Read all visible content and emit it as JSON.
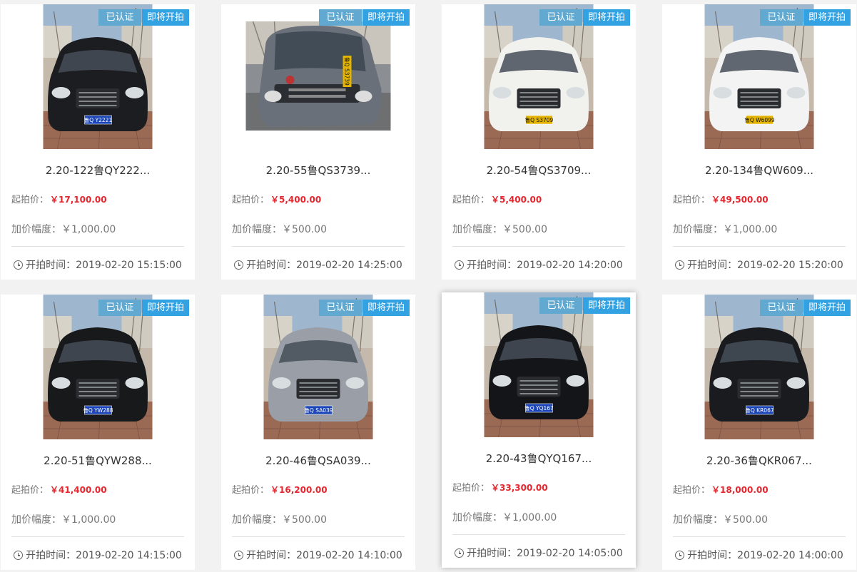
{
  "listings": [
    {
      "title": "2.20-122鲁QY222...",
      "start_price_label": "起拍价：",
      "start_price": "￥17,100.00",
      "increment_label": "加价幅度：",
      "increment": "￥1,000.00",
      "time_label": "开拍时间：",
      "time": "2019-02-20 15:15:00",
      "badge_certified": "已认证",
      "badge_status": "即将开拍",
      "plate": "鲁Q Y2221",
      "car_color": "#1c1d20",
      "plate_color": "#1c46b8"
    },
    {
      "title": "2.20-55鲁QS3739...",
      "start_price_label": "起拍价：",
      "start_price": "￥5,400.00",
      "increment_label": "加价幅度：",
      "increment": "￥500.00",
      "time_label": "开拍时间：",
      "time": "2019-02-20 14:25:00",
      "badge_certified": "已认证",
      "badge_status": "即将开拍",
      "plate": "鲁Q S3739",
      "car_color": "#6a7079",
      "plate_color": "#e4b400"
    },
    {
      "title": "2.20-54鲁QS3709...",
      "start_price_label": "起拍价：",
      "start_price": "￥5,400.00",
      "increment_label": "加价幅度：",
      "increment": "￥500.00",
      "time_label": "开拍时间：",
      "time": "2019-02-20 14:20:00",
      "badge_certified": "已认证",
      "badge_status": "即将开拍",
      "plate": "鲁Q S3709",
      "car_color": "#f1f1ee",
      "plate_color": "#e4b400"
    },
    {
      "title": "2.20-134鲁QW609...",
      "start_price_label": "起拍价：",
      "start_price": "￥49,500.00",
      "increment_label": "加价幅度：",
      "increment": "￥1,000.00",
      "time_label": "开拍时间：",
      "time": "2019-02-20 15:20:00",
      "badge_certified": "已认证",
      "badge_status": "即将开拍",
      "plate": "鲁Q W6099",
      "car_color": "#f3f3f3",
      "plate_color": "#e4b400"
    },
    {
      "title": "2.20-51鲁QYW288...",
      "start_price_label": "起拍价：",
      "start_price": "￥41,400.00",
      "increment_label": "加价幅度：",
      "increment": "￥1,000.00",
      "time_label": "开拍时间：",
      "time": "2019-02-20 14:15:00",
      "badge_certified": "已认证",
      "badge_status": "即将开拍",
      "plate": "鲁Q YW288",
      "car_color": "#18191b",
      "plate_color": "#1c46b8"
    },
    {
      "title": "2.20-46鲁QSA039...",
      "start_price_label": "起拍价：",
      "start_price": "￥16,200.00",
      "increment_label": "加价幅度：",
      "increment": "￥500.00",
      "time_label": "开拍时间：",
      "time": "2019-02-20 14:10:00",
      "badge_certified": "已认证",
      "badge_status": "即将开拍",
      "plate": "鲁Q SA039",
      "car_color": "#9a9ea6",
      "plate_color": "#1c46b8"
    },
    {
      "title": "2.20-43鲁QYQ167...",
      "start_price_label": "起拍价：",
      "start_price": "￥33,300.00",
      "increment_label": "加价幅度：",
      "increment": "￥1,000.00",
      "time_label": "开拍时间：",
      "time": "2019-02-20 14:05:00",
      "badge_certified": "已认证",
      "badge_status": "即将开拍",
      "plate": "鲁Q YQ167",
      "car_color": "#141518",
      "plate_color": "#1c46b8"
    },
    {
      "title": "2.20-36鲁QKR067...",
      "start_price_label": "起拍价：",
      "start_price": "￥18,000.00",
      "increment_label": "加价幅度：",
      "increment": "￥500.00",
      "time_label": "开拍时间：",
      "time": "2019-02-20 14:00:00",
      "badge_certified": "已认证",
      "badge_status": "即将开拍",
      "plate": "鲁Q KR067",
      "car_color": "#1a1b1f",
      "plate_color": "#1c46b8"
    }
  ]
}
